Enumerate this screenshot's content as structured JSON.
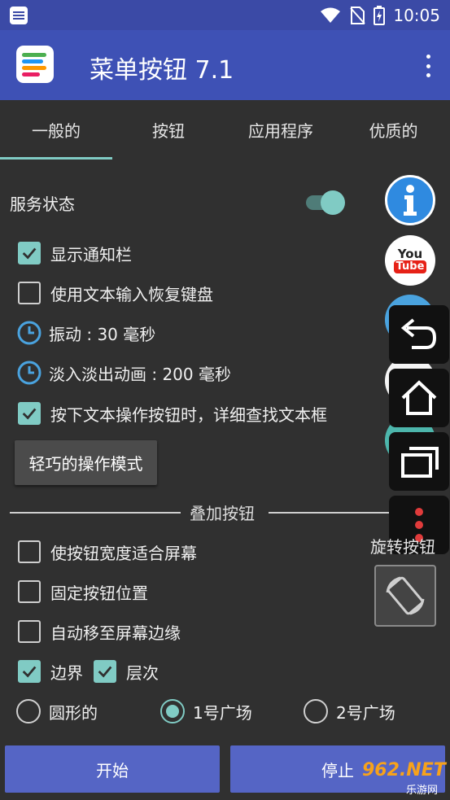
{
  "status_bar": {
    "time": "10:05"
  },
  "app_bar": {
    "title": "菜单按钮 7.1"
  },
  "tabs": [
    {
      "label": "一般的",
      "selected": true
    },
    {
      "label": "按钮",
      "selected": false
    },
    {
      "label": "应用程序",
      "selected": false
    },
    {
      "label": "优质的",
      "selected": false
    }
  ],
  "service_status": {
    "label": "服务状态",
    "enabled": true
  },
  "options": {
    "show_notification": {
      "label": "显示通知栏",
      "checked": true
    },
    "restore_keyboard": {
      "label": "使用文本输入恢复键盘",
      "checked": false
    },
    "vibration": {
      "label": "振动 : 30 毫秒"
    },
    "fade_animation": {
      "label": "淡入淡出动画 : 200 毫秒"
    },
    "find_textbox": {
      "label": "按下文本操作按钮时，详细查找文本框",
      "checked": true
    }
  },
  "gesture_mode_button": "轻巧的操作模式",
  "overlay_section": {
    "title": "叠加按钮",
    "fit_width": {
      "label": "使按钮宽度适合屏幕",
      "checked": false
    },
    "fix_position": {
      "label": "固定按钮位置",
      "checked": false
    },
    "snap_edge": {
      "label": "自动移至屏幕边缘",
      "checked": false
    },
    "border": {
      "label": "边界",
      "checked": true
    },
    "layer": {
      "label": "层次",
      "checked": true
    },
    "shape_options": [
      {
        "label": "圆形的",
        "selected": false
      },
      {
        "label": "1号广场",
        "selected": true
      },
      {
        "label": "2号广场",
        "selected": false
      }
    ]
  },
  "floating_panel": {
    "rotate_label": "旋转按钮",
    "youtube_text_1": "You",
    "youtube_text_2": "Tube"
  },
  "buttons": {
    "start": "开始",
    "stop": "停止"
  },
  "watermark": {
    "text": "962.NET",
    "sub": "乐游网"
  },
  "colors": {
    "primary": "#3e51b5",
    "accent": "#80cbc4",
    "background": "#303030",
    "button": "#5565c5"
  }
}
